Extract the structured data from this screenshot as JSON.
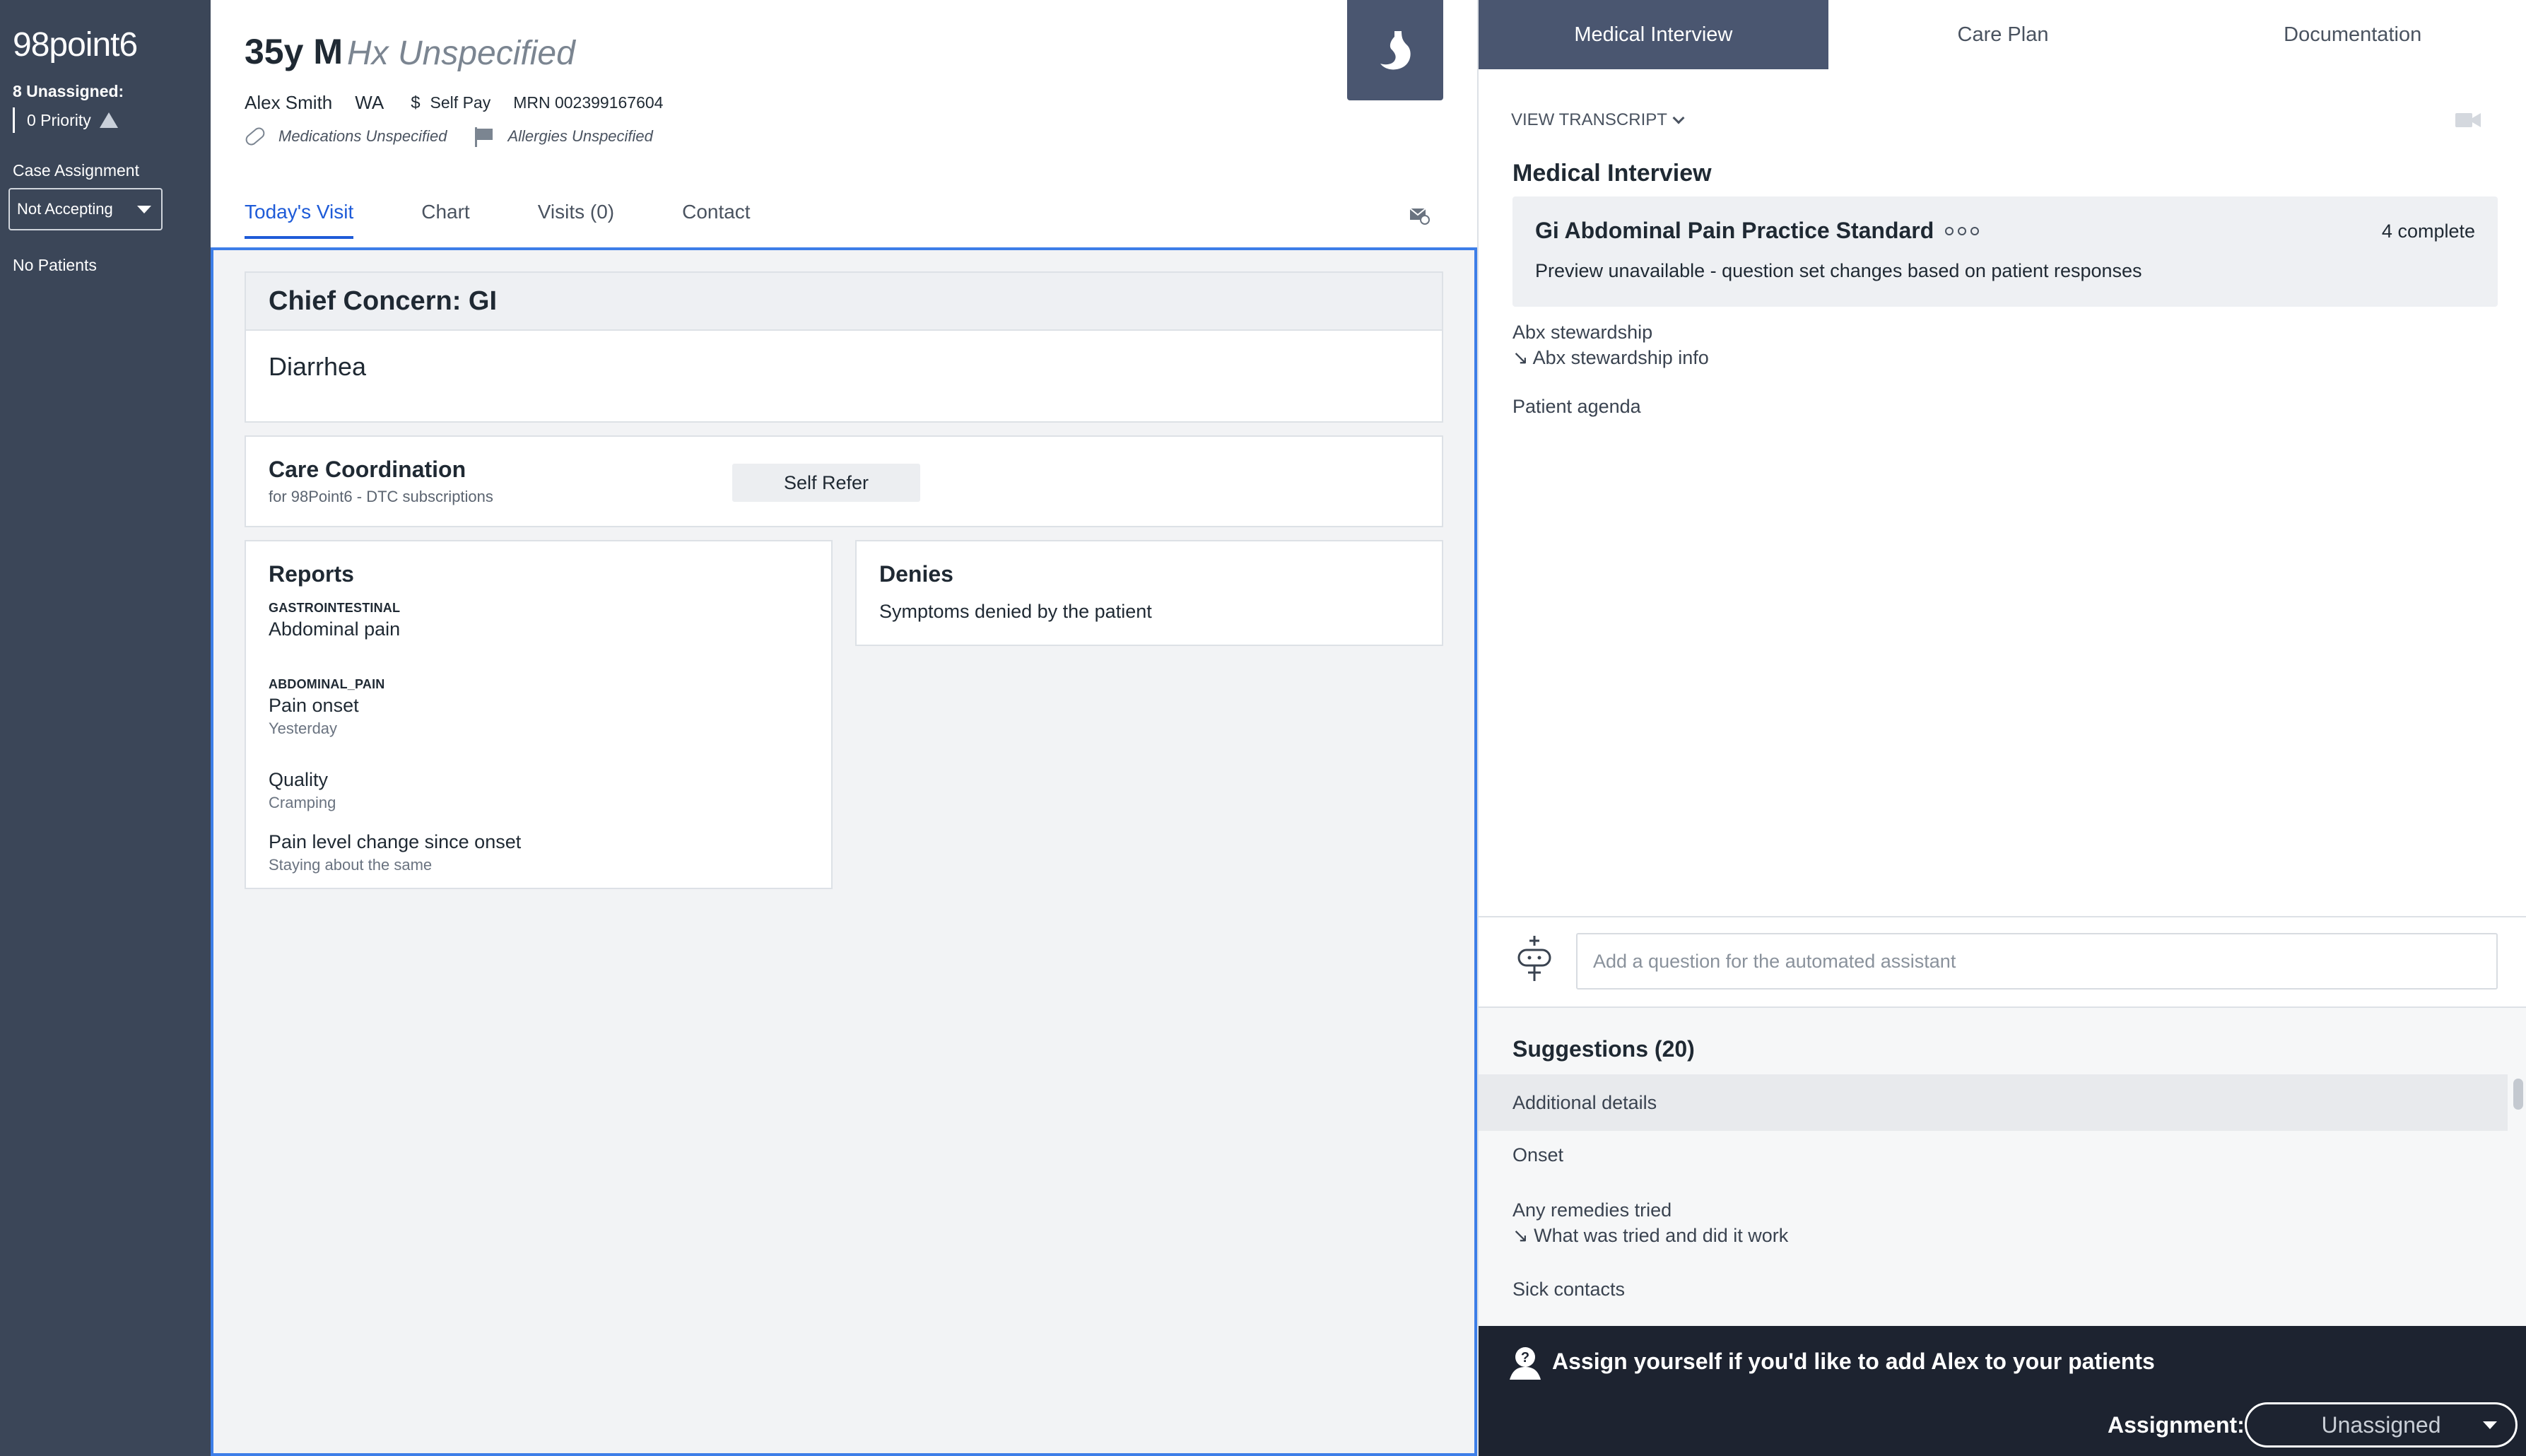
{
  "sidebar": {
    "logo": "98point6",
    "unassigned": "8 Unassigned:",
    "priority": "0 Priority",
    "case_assignment_label": "Case Assignment",
    "case_assignment_value": "Not Accepting",
    "no_patients": "No Patients",
    "bg_color": "#3b4658"
  },
  "patient": {
    "age_sex": "35y M",
    "hx": "Hx Unspecified",
    "name": "Alex Smith",
    "state": "WA",
    "pay_symbol": "$",
    "pay": "Self Pay",
    "mrn": "MRN 002399167604",
    "medications": "Medications Unspecified",
    "allergies": "Allergies Unspecified"
  },
  "tabs": [
    {
      "label": "Today's Visit",
      "active": true
    },
    {
      "label": "Chart"
    },
    {
      "label": "Visits (0)"
    },
    {
      "label": "Contact"
    }
  ],
  "chief_concern": {
    "title": "Chief Concern:  GI",
    "value": "Diarrhea"
  },
  "care_coordination": {
    "title": "Care Coordination",
    "subtitle": "for 98Point6 - DTC subscriptions",
    "button": "Self Refer"
  },
  "reports": {
    "title": "Reports",
    "groups": [
      {
        "category": "GASTROINTESTINAL",
        "item": "Abdominal pain"
      },
      {
        "category": "ABDOMINAL_PAIN",
        "item": "Pain onset",
        "value": "Yesterday"
      },
      {
        "item": "Quality",
        "value": "Cramping"
      },
      {
        "item": "Pain level change since onset",
        "value": "Staying about the same"
      }
    ]
  },
  "denies": {
    "title": "Denies",
    "text": "Symptoms denied by the patient"
  },
  "right_tabs": [
    {
      "label": "Medical Interview",
      "active": true
    },
    {
      "label": "Care Plan"
    },
    {
      "label": "Documentation"
    }
  ],
  "interview": {
    "view_transcript": "VIEW TRANSCRIPT",
    "title": "Medical Interview",
    "standard_title": "Gi Abdominal Pain Practice Standard",
    "complete": "4 complete",
    "preview": "Preview unavailable - question set changes based on patient responses",
    "abx": "Abx stewardship",
    "abx_info": "↘ Abx stewardship info",
    "agenda": "Patient agenda",
    "input_placeholder": "Add a question for the automated assistant"
  },
  "suggestions": {
    "title": "Suggestions (20)",
    "items": [
      {
        "label": "Additional details"
      },
      {
        "label": "Onset"
      },
      {
        "label": "Any remedies tried",
        "sub": "↘ What was tried and did it work"
      },
      {
        "label": "Sick contacts"
      }
    ]
  },
  "footer": {
    "message": "Assign yourself if you'd like to add Alex to your patients",
    "assignment_label": "Assignment:",
    "assignment_value": "Unassigned"
  },
  "colors": {
    "accent": "#1e5bd8",
    "active_tab_bg": "#4a5670",
    "footer_bg": "#1d2330"
  }
}
